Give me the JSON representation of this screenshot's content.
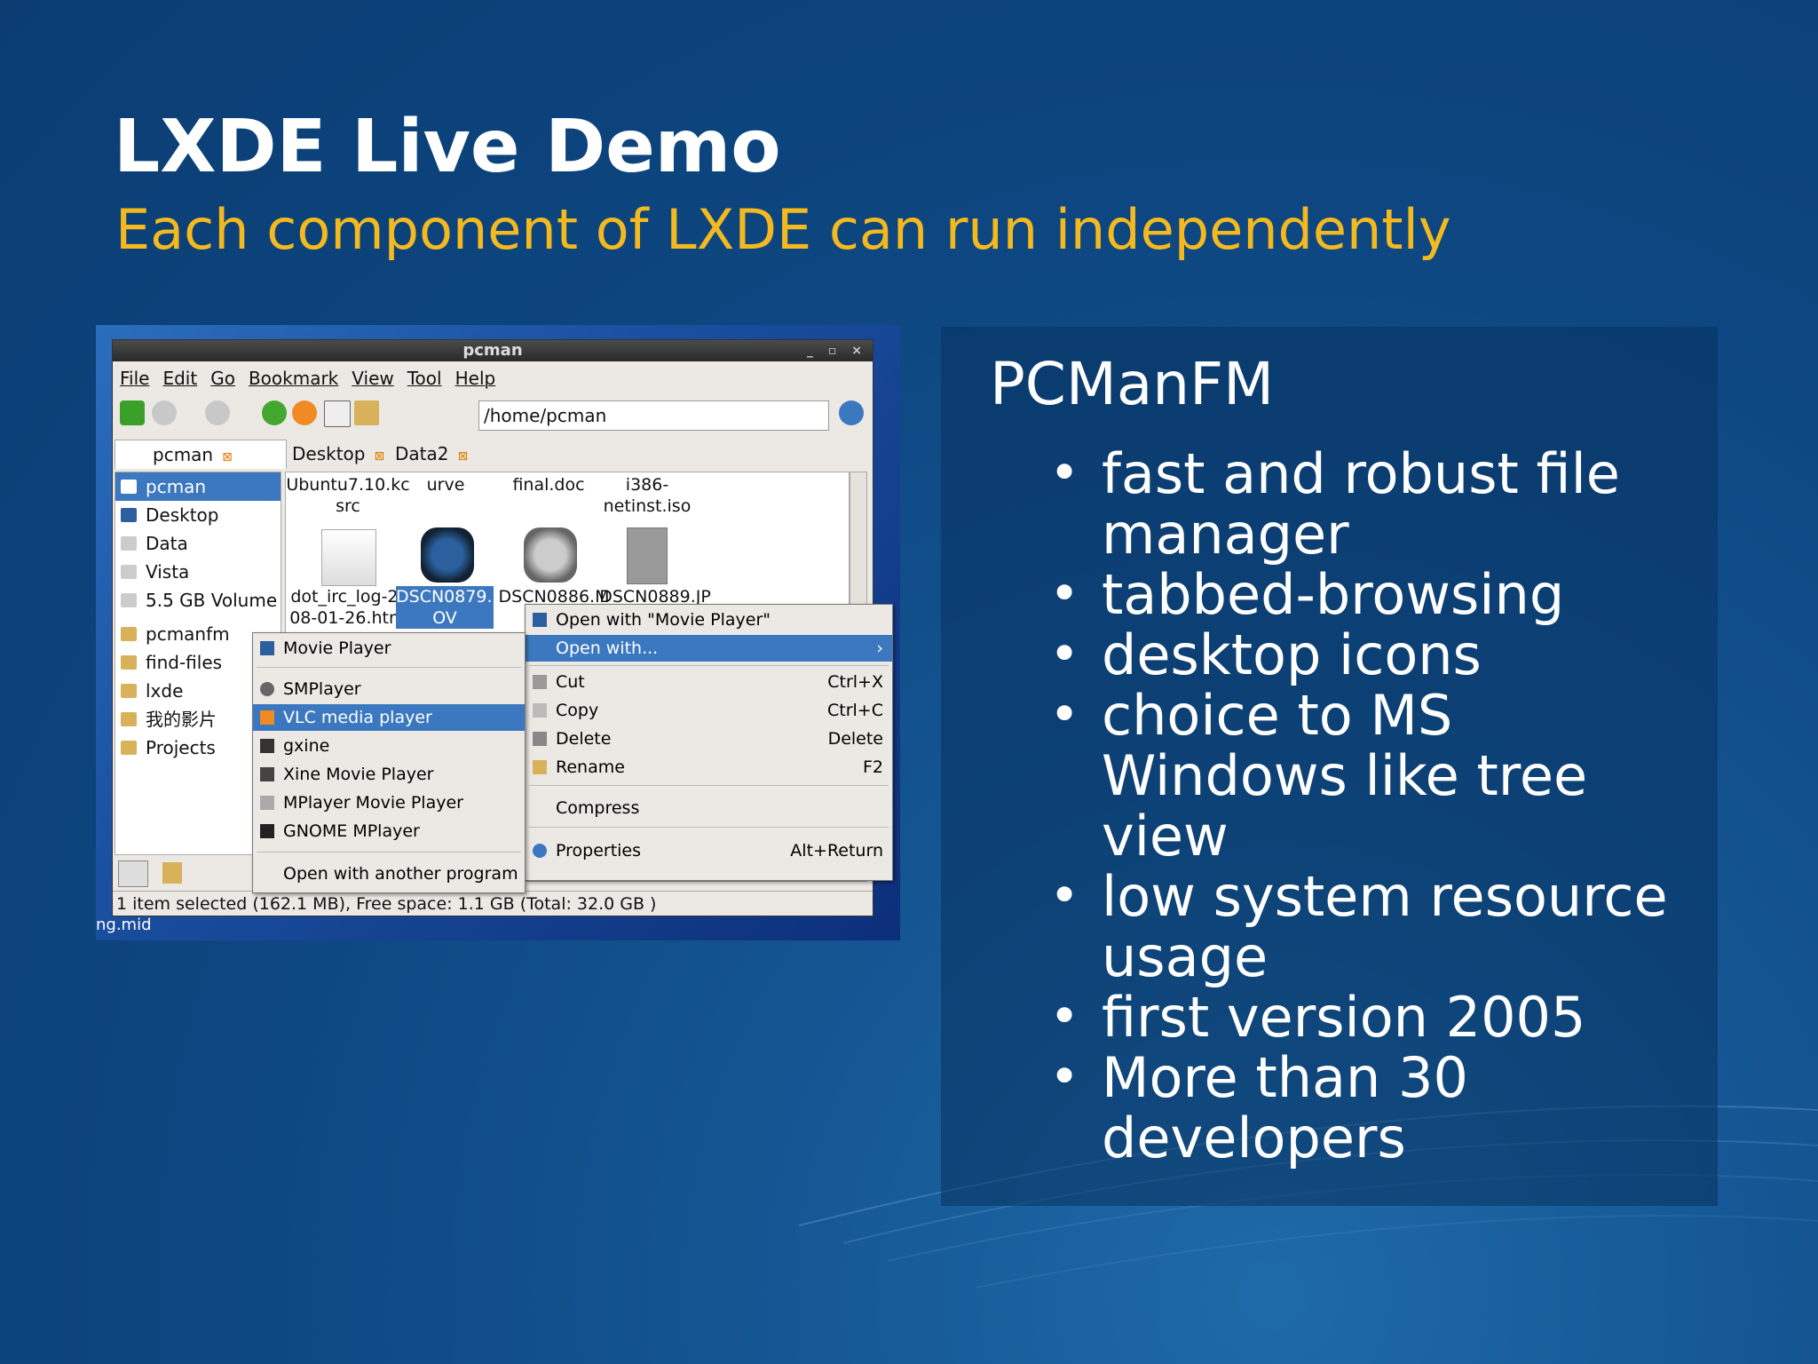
{
  "slide": {
    "title": "LXDE Live Demo",
    "subtitle": "Each component of LXDE can run independently"
  },
  "panel": {
    "title": "PCManFM",
    "features": [
      "fast and robust file manager",
      "tabbed-browsing",
      "desktop icons",
      "choice to MS Windows like tree view",
      "low system resource usage",
      "first version 2005",
      "More than 30 developers"
    ]
  },
  "screenshot": {
    "window_title": "pcman",
    "menu": [
      "File",
      "Edit",
      "Go",
      "Bookmark",
      "View",
      "Tool",
      "Help"
    ],
    "path": "/home/pcman",
    "tabs": [
      "pcman",
      "Desktop",
      "Data2"
    ],
    "places": [
      "pcman",
      "Desktop",
      "Data",
      "Vista",
      "5.5 GB Volume"
    ],
    "bookmarks": [
      "pcmanfm",
      "find-files",
      "lxde",
      "我的影片",
      "Projects"
    ],
    "files_row1": [
      "Ubuntu7.10.kc src",
      "urve",
      "final.doc",
      "i386-netinst.iso"
    ],
    "files_row2": [
      "dot_irc_log-20 08-01-26.html",
      "DSCN0879.M OV",
      "DSCN0886.M",
      "DSCN0889.JP"
    ],
    "context_menu": {
      "open_with_default": "Open with \"Movie Player\"",
      "open_with": "Open with...",
      "cut": "Cut",
      "cut_key": "Ctrl+X",
      "copy": "Copy",
      "copy_key": "Ctrl+C",
      "delete": "Delete",
      "delete_key": "Delete",
      "rename": "Rename",
      "rename_key": "F2",
      "compress": "Compress",
      "properties": "Properties",
      "properties_key": "Alt+Return"
    },
    "open_with_submenu": {
      "items": [
        "Movie Player",
        "SMPlayer",
        "VLC media player",
        "gxine",
        "Xine Movie Player",
        "MPlayer Movie Player",
        "GNOME MPlayer"
      ],
      "other": "Open with another program"
    },
    "status": "1 item selected (162.1 MB), Free space: 1.1 GB (Total: 32.0 GB )",
    "desktop_label": "ng.mid"
  },
  "colors": {
    "accent": "#f3b91f",
    "selection": "#3c78c0",
    "background": "#0d4680"
  }
}
